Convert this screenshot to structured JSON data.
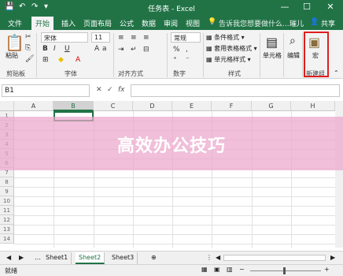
{
  "window": {
    "title": "任务表 - Excel",
    "minimize": "—",
    "maximize": "☐",
    "close": "✕"
  },
  "qat": {
    "save": "💾",
    "undo": "↶",
    "redo": "↷",
    "more": "▾"
  },
  "tabs": [
    "文件",
    "开始",
    "插入",
    "页面布局",
    "公式",
    "数据",
    "审阅",
    "视图"
  ],
  "active_tab": "开始",
  "tell_me": "告诉我您想要做什么...",
  "user": "璀儿",
  "share": "共享",
  "ribbon": {
    "clipboard": {
      "paste": "粘贴",
      "label": "剪贴板"
    },
    "font": {
      "name": "宋体",
      "size": "11",
      "bold": "B",
      "italic": "I",
      "underline": "U",
      "label": "字体"
    },
    "alignment": {
      "label": "对齐方式"
    },
    "number": {
      "format": "常规",
      "label": "数字",
      "percent": "%"
    },
    "styles": {
      "conditional": "条件格式",
      "table": "套用表格格式",
      "cell": "单元格样式",
      "label": "样式"
    },
    "cells": {
      "label": "单元格"
    },
    "editing": {
      "label": "编辑"
    },
    "macro": {
      "button": "宏",
      "label": "新建组"
    }
  },
  "formula_bar": {
    "name_box": "B1",
    "fx": "fx",
    "value": ""
  },
  "columns": [
    "A",
    "B",
    "C",
    "D",
    "E",
    "F",
    "G",
    "H"
  ],
  "rows": [
    "1",
    "2",
    "3",
    "4",
    "5",
    "6",
    "7",
    "8",
    "9",
    "10",
    "11",
    "12",
    "13",
    "14"
  ],
  "sheets": [
    "Sheet1",
    "Sheet2",
    "Sheet3"
  ],
  "active_sheet": "Sheet2",
  "status": {
    "ready": "就绪"
  },
  "banner": {
    "text": "高效办公技巧"
  }
}
